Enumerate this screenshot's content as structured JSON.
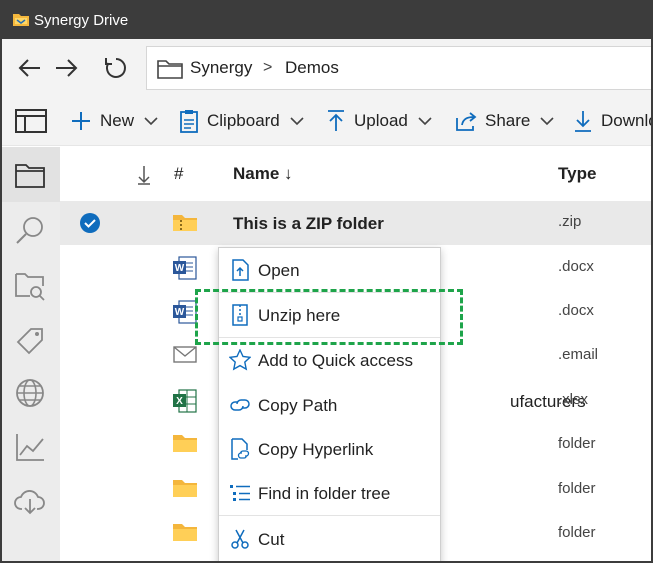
{
  "window": {
    "title": "Synergy Drive"
  },
  "nav": {
    "back_icon": "back-arrow-icon",
    "forward_icon": "forward-arrow-icon",
    "refresh_icon": "refresh-icon",
    "breadcrumb": [
      "Synergy",
      "Demos"
    ],
    "separator": ">"
  },
  "toolbar": {
    "items": [
      {
        "label": "New",
        "icon": "plus-icon"
      },
      {
        "label": "Clipboard",
        "icon": "clipboard-icon"
      },
      {
        "label": "Upload",
        "icon": "upload-icon"
      },
      {
        "label": "Share",
        "icon": "share-icon"
      },
      {
        "label": "Downlo",
        "icon": "download-icon"
      }
    ]
  },
  "sidebar": {
    "items": [
      "folder-icon",
      "search-icon",
      "folder-search-icon",
      "tag-icon",
      "globe-icon",
      "chart-icon",
      "cloud-download-icon"
    ]
  },
  "list": {
    "header": {
      "sort_icon": "sort-down-arrow-icon",
      "index_col": "#",
      "name_col": "Name ↓",
      "type_col": "Type"
    },
    "rows": [
      {
        "name": "This is a ZIP folder",
        "type": ".zip",
        "icon": "zip-folder-icon",
        "selected": true
      },
      {
        "name": "",
        "type": ".docx",
        "icon": "word-icon",
        "selected": false
      },
      {
        "name": "",
        "type": ".docx",
        "icon": "word-icon",
        "selected": false
      },
      {
        "name": "",
        "type": ".email",
        "icon": "email-icon",
        "selected": false
      },
      {
        "name": "ufacturers",
        "type": ".xlsx",
        "icon": "excel-icon",
        "selected": false
      },
      {
        "name": "",
        "type": "folder",
        "icon": "folder-icon",
        "selected": false
      },
      {
        "name": "",
        "type": "folder",
        "icon": "folder-icon",
        "selected": false
      },
      {
        "name": "",
        "type": "folder",
        "icon": "folder-icon",
        "selected": false
      }
    ]
  },
  "context_menu": {
    "items": [
      {
        "label": "Open",
        "icon": "open-icon"
      },
      {
        "label": "Unzip here",
        "icon": "zip-file-icon"
      },
      {
        "label": "Add to Quick access",
        "icon": "star-icon"
      },
      {
        "label": "Copy Path",
        "icon": "link-icon"
      },
      {
        "label": "Copy Hyperlink",
        "icon": "hyperlink-icon"
      },
      {
        "label": "Find in folder tree",
        "icon": "tree-list-icon"
      },
      {
        "label": "Cut",
        "icon": "scissors-icon"
      }
    ]
  },
  "colors": {
    "accent": "#0f6cbd",
    "highlight_border": "#1ea44a",
    "titlebar": "#3c3c3c"
  }
}
